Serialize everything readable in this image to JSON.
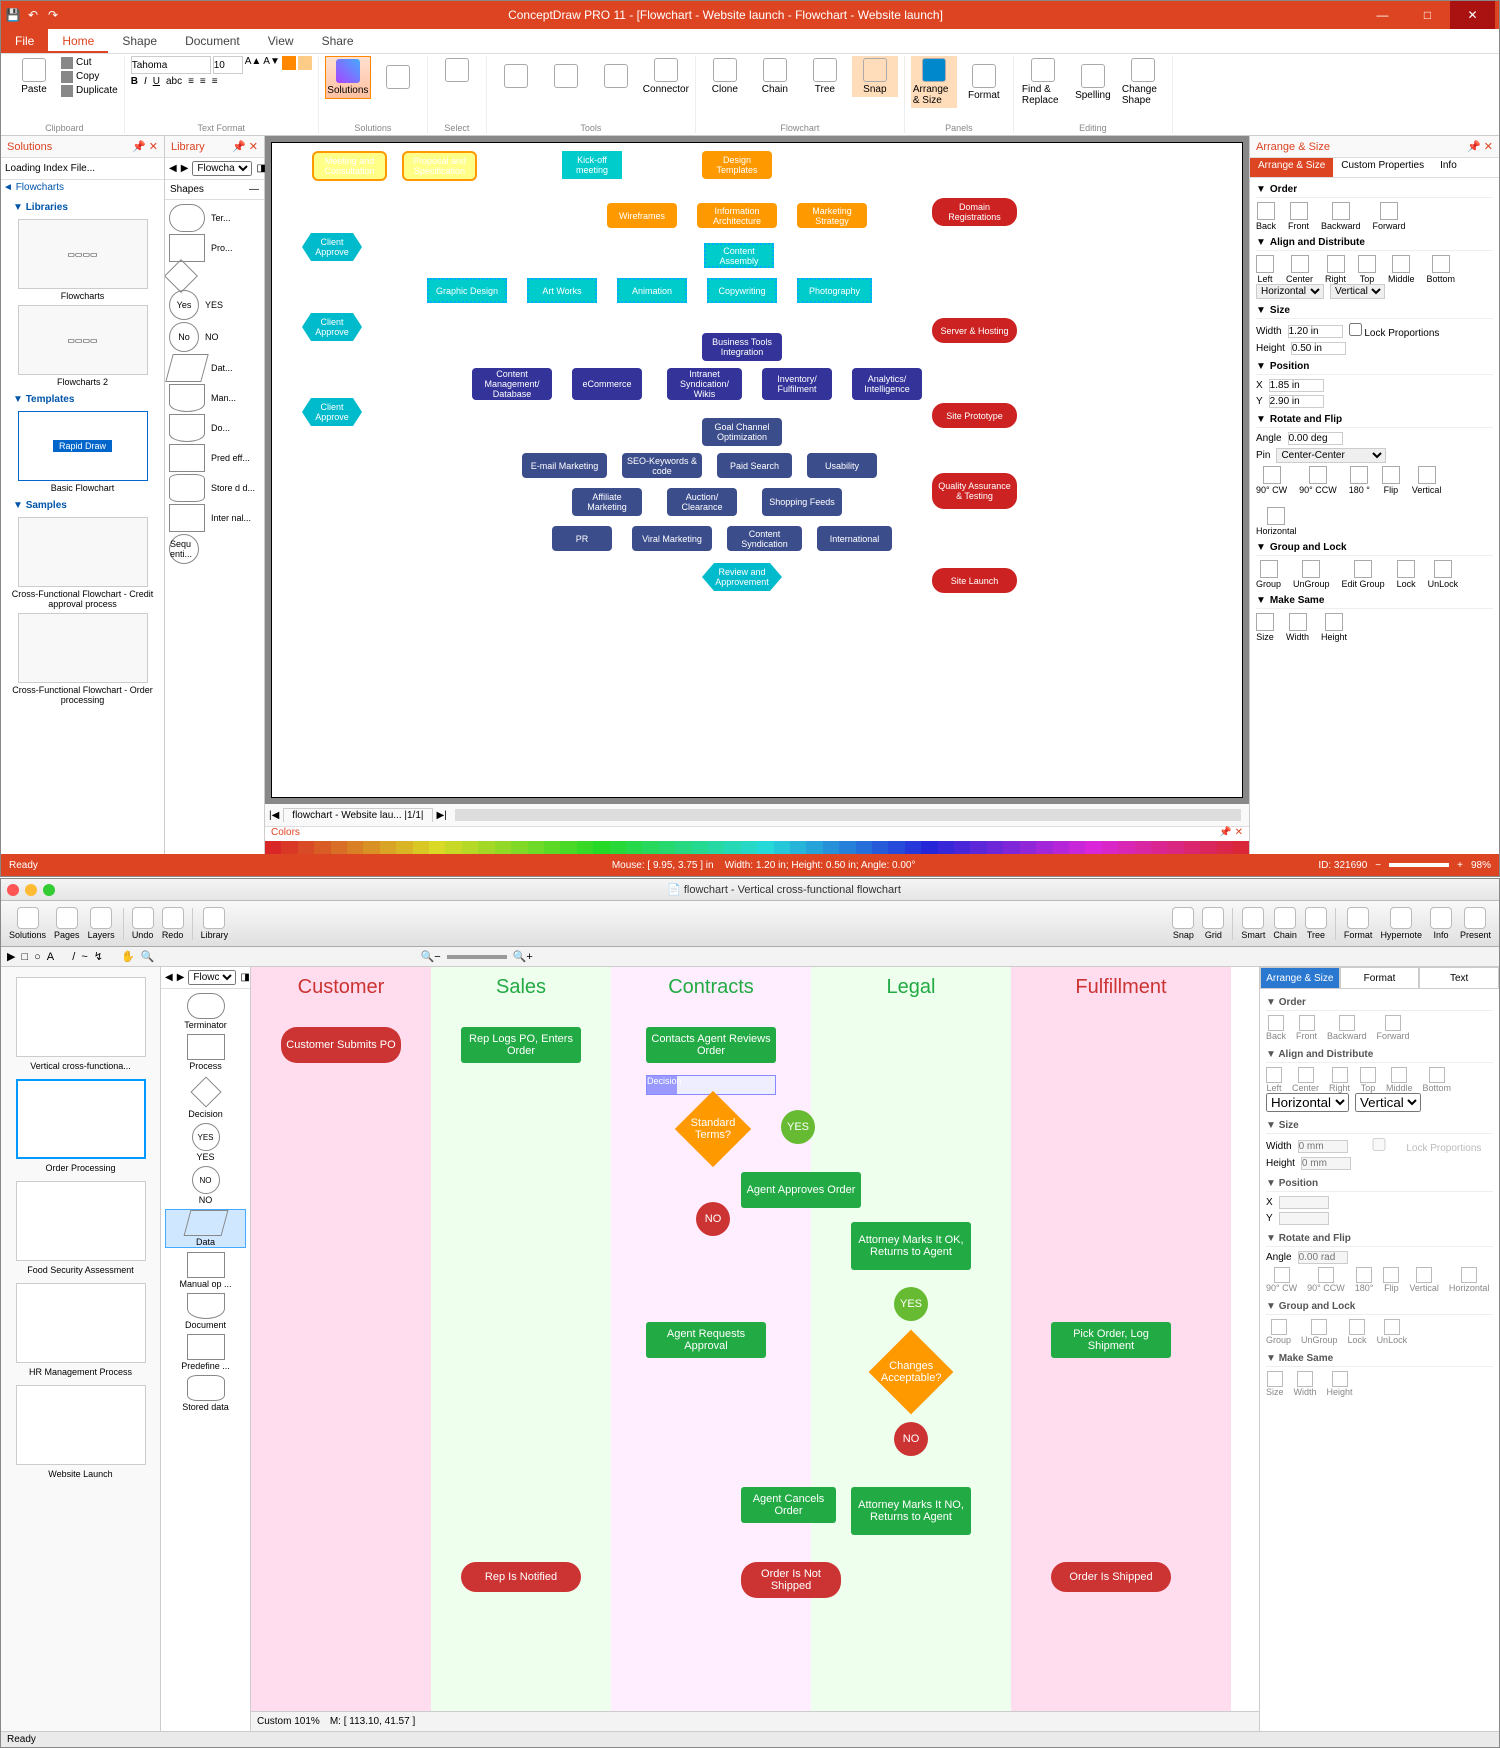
{
  "app1": {
    "title": "ConceptDraw PRO 11 - [Flowchart - Website launch - Flowchart - Website launch]",
    "qat": [
      "💾",
      "↶",
      "↷"
    ],
    "sysbtns": {
      "min": "—",
      "max": "□",
      "close": "✕"
    },
    "tabs": [
      "File",
      "Home",
      "Shape",
      "Document",
      "View",
      "Share"
    ],
    "ribbon": {
      "clipboard_label": "Clipboard",
      "paste": "Paste",
      "cut": "Cut",
      "copy": "Copy",
      "duplicate": "Duplicate",
      "text_label": "Text Format",
      "font": "Tahoma",
      "size": "10",
      "solutions_label": "Solutions",
      "solutions": "Solutions",
      "select_label": "Select",
      "tools_label": "Tools",
      "connector": "Connector",
      "flow_label": "Flowchart",
      "clone": "Clone",
      "chain": "Chain",
      "tree": "Tree",
      "snap": "Snap",
      "arrange": "Arrange & Size",
      "format": "Format",
      "panels_label": "Panels",
      "editing_label": "Editing",
      "find": "Find & Replace",
      "spelling": "Spelling",
      "change": "Change Shape"
    },
    "solutions_panel": {
      "title": "Solutions",
      "search": "Loading Index File...",
      "root": "Flowcharts",
      "categories": [
        {
          "name": "Libraries",
          "items": [
            {
              "label": "Flowcharts"
            },
            {
              "label": "Flowcharts 2"
            }
          ]
        },
        {
          "name": "Templates",
          "items": [
            {
              "label": "Basic Flowchart",
              "rapid": "Rapid Draw"
            }
          ]
        },
        {
          "name": "Samples",
          "items": [
            {
              "label": "Cross-Functional Flowchart - Credit approval process"
            },
            {
              "label": "Cross-Functional Flowchart - Order processing"
            }
          ]
        }
      ]
    },
    "library_panel": {
      "title": "Library",
      "tab": "Flowchar...",
      "cat": "Shapes",
      "shapes": [
        {
          "t": "round",
          "l": "Ter..."
        },
        {
          "t": "",
          "l": "Pro..."
        },
        {
          "t": "diamond",
          "l": ""
        },
        {
          "t": "circle",
          "l": "YES",
          "cap": "Yes"
        },
        {
          "t": "circle",
          "l": "NO",
          "cap": "No"
        },
        {
          "t": "para",
          "l": "Dat..."
        },
        {
          "t": "doc",
          "l": "Man..."
        },
        {
          "t": "doc",
          "l": "Do..."
        },
        {
          "t": "",
          "l": "Pred eff..."
        },
        {
          "t": "cylinder",
          "l": "Store d d..."
        },
        {
          "t": "",
          "l": "Inter nal..."
        },
        {
          "t": "circle",
          "l": "",
          "cap": "Sequ enti..."
        }
      ]
    },
    "right_panel": {
      "title": "Arrange & Size",
      "tabs": [
        "Arrange & Size",
        "Custom Properties",
        "Info"
      ],
      "order": {
        "title": "Order",
        "items": [
          "Back",
          "Front",
          "Backward",
          "Forward"
        ]
      },
      "align": {
        "title": "Align and Distribute",
        "items": [
          "Left",
          "Center",
          "Right",
          "Top",
          "Middle",
          "Bottom"
        ],
        "horiz": "Horizontal",
        "vert": "Vertical"
      },
      "size": {
        "title": "Size",
        "w_lab": "Width",
        "w": "1.20 in",
        "h_lab": "Height",
        "h": "0.50 in",
        "lock": "Lock Proportions"
      },
      "position": {
        "title": "Position",
        "x_lab": "X",
        "x": "1.85 in",
        "y_lab": "Y",
        "y": "2.90 in"
      },
      "rotate": {
        "title": "Rotate and Flip",
        "angle_lab": "Angle",
        "angle": "0.00 deg",
        "pin_lab": "Pin",
        "pin": "Center-Center",
        "items": [
          "90° CW",
          "90° CCW",
          "180 °",
          "Flip",
          "Vertical",
          "Horizontal"
        ]
      },
      "grouplock": {
        "title": "Group and Lock",
        "items": [
          "Group",
          "UnGroup",
          "Edit Group",
          "Lock",
          "UnLock"
        ]
      },
      "same": {
        "title": "Make Same",
        "items": [
          "Size",
          "Width",
          "Height"
        ]
      }
    },
    "doctab": "flowchart - Website lau...",
    "page_info": "|1/1|",
    "colors_label": "Colors",
    "status": {
      "ready": "Ready",
      "mouse": "Mouse: [ 9.95, 3.75 ] in",
      "size": "Width: 1.20 in; Height: 0.50 in; Angle: 0.00°",
      "id": "ID: 321690",
      "zoom": "98%"
    },
    "flow_nodes": {
      "meeting": "Meeting and Consultation",
      "proposal": "Proposal and Specification",
      "kickoff": "Kick-off meeting",
      "templates": "Design Templates",
      "wireframes": "Wireframes",
      "infoarch": "Information Architecture",
      "mktg": "Marketing Strategy",
      "domain": "Domain Registrations",
      "approve1": "Client Approve",
      "content_asm": "Content Assembly",
      "graphic": "Graphic Design",
      "art": "Art Works",
      "anim": "Animation",
      "copy": "Copywriting",
      "photo": "Photography",
      "approve2": "Client Approve",
      "server": "Server & Hosting",
      "biztools": "Business Tools Integration",
      "cms": "Content Management/ Database",
      "ecomm": "eCommerce",
      "intranet": "Intranet Syndication/ Wikis",
      "inventory": "Inventory/ Fulfilment",
      "analytics": "Analytics/ Intelligence",
      "approve3": "Client Approve",
      "goalchan": "Goal Channel Optimization",
      "siteproto": "Site Prototype",
      "email": "E-mail Marketing",
      "seo": "SEO-Keywords & code",
      "paid": "Paid Search",
      "usability": "Usability",
      "affiliate": "Affiliate Marketing",
      "auction": "Auction/ Clearance",
      "shopping": "Shopping Feeds",
      "qat_node": "Quality Assurance & Testing",
      "pr": "PR",
      "viral": "Viral Marketing",
      "synd": "Content Syndication",
      "intl": "International",
      "review": "Review and Approvement",
      "launch": "Site Launch"
    }
  },
  "app2": {
    "title": "flowchart - Vertical cross-functional flowchart",
    "toolbar": {
      "solutions": "Solutions",
      "pages": "Pages",
      "layers": "Layers",
      "undo": "Undo",
      "redo": "Redo",
      "library": "Library",
      "snap": "Snap",
      "grid": "Grid",
      "smart": "Smart",
      "chain": "Chain",
      "tree": "Tree",
      "format": "Format",
      "hypernote": "Hypernote",
      "info": "Info",
      "present": "Present"
    },
    "thumbs": [
      {
        "label": "Vertical cross-functiona..."
      },
      {
        "label": "Order Processing",
        "sel": true
      },
      {
        "label": "Food Security Assessment"
      },
      {
        "label": "HR Management Process"
      },
      {
        "label": "Website Launch"
      }
    ],
    "shapes_tab": "Flowc...",
    "shapes": [
      {
        "t": "round",
        "l": "Terminator"
      },
      {
        "t": "",
        "l": "Process"
      },
      {
        "t": "diamond",
        "l": "Decision"
      },
      {
        "t": "circle",
        "l": "YES",
        "cap": "YES"
      },
      {
        "t": "circle",
        "l": "NO",
        "cap": "NO"
      },
      {
        "t": "para",
        "l": "Data",
        "sel": true
      },
      {
        "t": "",
        "l": "Manual op ..."
      },
      {
        "t": "doc",
        "l": "Document"
      },
      {
        "t": "",
        "l": "Predefine ..."
      },
      {
        "t": "cylinder",
        "l": "Stored data"
      }
    ],
    "lanes": [
      "Customer",
      "Sales",
      "Contracts",
      "Legal",
      "Fulfillment"
    ],
    "nodes": {
      "submit": "Customer Submits PO",
      "replogs": "Rep Logs PO, Enters Order",
      "contacts": "Contacts Agent Reviews Order",
      "decision": "Decision",
      "standard": "Standard Terms?",
      "yes": "YES",
      "no": "NO",
      "approves": "Agent Approves Order",
      "att_ok": "Attorney Marks It OK, Returns to Agent",
      "changes": "Changes Acceptable?",
      "requests": "Agent Requests Approval",
      "pick": "Pick Order, Log Shipment",
      "att_no": "Attorney Marks It NO, Returns to Agent",
      "cancels": "Agent Cancels Order",
      "notified": "Rep Is Notified",
      "notshipped": "Order Is Not Shipped",
      "shipped": "Order Is Shipped"
    },
    "right": {
      "tabs": [
        "Arrange & Size",
        "Format",
        "Text"
      ],
      "order": {
        "title": "Order",
        "items": [
          "Back",
          "Front",
          "Backward",
          "Forward"
        ]
      },
      "align": {
        "title": "Align and Distribute",
        "items": [
          "Left",
          "Center",
          "Right",
          "Top",
          "Middle",
          "Bottom"
        ],
        "horiz": "Horizontal",
        "vert": "Vertical"
      },
      "size": {
        "title": "Size",
        "w_lab": "Width",
        "w": "0 mm",
        "h_lab": "Height",
        "h": "0 mm",
        "lock": "Lock Proportions"
      },
      "position": {
        "title": "Position",
        "x_lab": "X",
        "x": "",
        "y_lab": "Y",
        "y": ""
      },
      "rotate": {
        "title": "Rotate and Flip",
        "angle_lab": "Angle",
        "angle": "0.00 rad",
        "items": [
          "90° CW",
          "90° CCW",
          "180°",
          "Flip",
          "Vertical",
          "Horizontal"
        ]
      },
      "grouplock": {
        "title": "Group and Lock",
        "items": [
          "Group",
          "UnGroup",
          "Lock",
          "UnLock"
        ]
      },
      "same": {
        "title": "Make Same",
        "items": [
          "Size",
          "Width",
          "Height"
        ]
      }
    },
    "bottom": {
      "zoom": "Custom 101%",
      "mouse": "M: [ 113.10, 41.57 ]"
    },
    "status": "Ready"
  }
}
